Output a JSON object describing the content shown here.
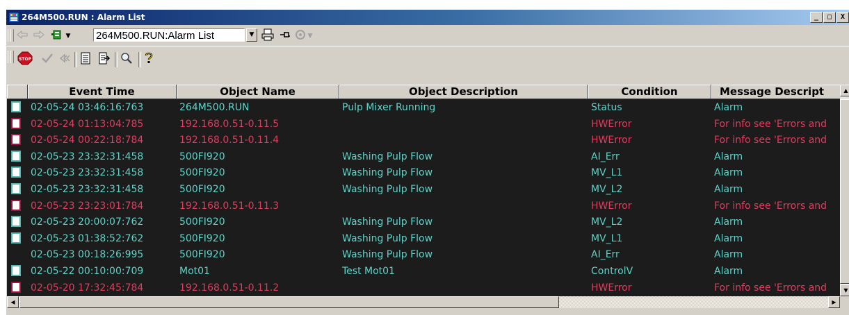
{
  "window": {
    "title": "264M500.RUN : Alarm List",
    "title_icon": "alarm-list-app-icon",
    "caption_buttons": [
      "_",
      "□",
      "X"
    ]
  },
  "toolbar1": {
    "back_icon": "back-arrow-icon",
    "forward_icon": "forward-arrow-icon",
    "view_icon": "view-menu-icon",
    "address_value": "264M500.RUN:Alarm List",
    "print_icon": "print-icon",
    "pin_icon": "pin-icon",
    "overview_icon": "overview-icon"
  },
  "toolbar2": {
    "stop_icon": "stop-icon",
    "acknowledge_icon": "checkmark-icon",
    "silence_icon": "silence-icon",
    "list_icon": "list-icon",
    "export_icon": "export-icon",
    "search_icon": "magnifier-icon",
    "help_icon": "help-icon"
  },
  "colors": {
    "normal": "#5fd3c8",
    "error": "#e23b5e",
    "grid_bg": "#1c1c1c",
    "ack_normal_border": "#4fb8b0",
    "ack_error_border": "#a3123d"
  },
  "columns": [
    "Event Time",
    "Object Name",
    "Object Description",
    "Condition",
    "Message Descript"
  ],
  "rows": [
    {
      "time": "02-05-24 03:46:16:763",
      "object": "264M500.RUN",
      "description": "Pulp Mixer Running",
      "condition": "Status",
      "message": "Alarm",
      "type": "normal",
      "ack": true
    },
    {
      "time": "02-05-24 01:13:04:785",
      "object": "192.168.0.51-0.11.5",
      "description": "",
      "condition": "HWError",
      "message": "For info see 'Errors and",
      "type": "error",
      "ack": true
    },
    {
      "time": "02-05-24 00:22:18:784",
      "object": "192.168.0.51-0.11.4",
      "description": "",
      "condition": "HWError",
      "message": "For info see 'Errors and",
      "type": "error",
      "ack": true
    },
    {
      "time": "02-05-23 23:32:31:458",
      "object": "500FI920",
      "description": "Washing Pulp Flow",
      "condition": "AI_Err",
      "message": "Alarm",
      "type": "normal",
      "ack": true
    },
    {
      "time": "02-05-23 23:32:31:458",
      "object": "500FI920",
      "description": "Washing Pulp Flow",
      "condition": "MV_L1",
      "message": "Alarm",
      "type": "normal",
      "ack": true
    },
    {
      "time": "02-05-23 23:32:31:458",
      "object": "500FI920",
      "description": "Washing Pulp Flow",
      "condition": "MV_L2",
      "message": "Alarm",
      "type": "normal",
      "ack": true
    },
    {
      "time": "02-05-23 23:23:01:784",
      "object": "192.168.0.51-0.11.3",
      "description": "",
      "condition": "HWError",
      "message": "For info see 'Errors and",
      "type": "error",
      "ack": true
    },
    {
      "time": "02-05-23 20:00:07:762",
      "object": "500FI920",
      "description": "Washing Pulp Flow",
      "condition": "MV_L2",
      "message": "Alarm",
      "type": "normal",
      "ack": true
    },
    {
      "time": "02-05-23 01:38:52:762",
      "object": "500FI920",
      "description": "Washing Pulp Flow",
      "condition": "MV_L1",
      "message": "Alarm",
      "type": "normal",
      "ack": true
    },
    {
      "time": "02-05-23 00:18:26:995",
      "object": "500FI920",
      "description": "Washing Pulp Flow",
      "condition": "AI_Err",
      "message": "Alarm",
      "type": "normal",
      "ack": false
    },
    {
      "time": "02-05-22 00:10:00:709",
      "object": "Mot01",
      "description": "Test Mot01",
      "condition": "ControlV",
      "message": "Alarm",
      "type": "normal",
      "ack": true
    },
    {
      "time": "02-05-20 17:32:45:784",
      "object": "192.168.0.51-0.11.2",
      "description": "",
      "condition": "HWError",
      "message": "For info see 'Errors and",
      "type": "error",
      "ack": true
    }
  ]
}
